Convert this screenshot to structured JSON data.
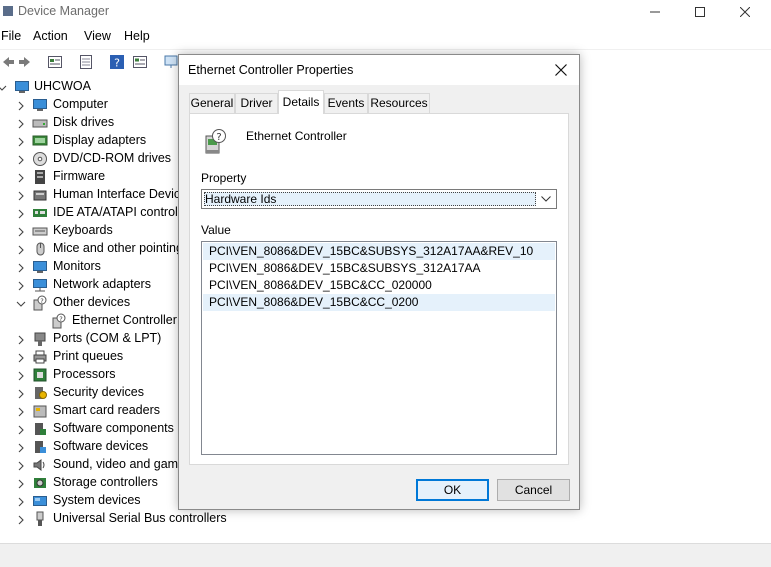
{
  "window": {
    "title": "Device Manager",
    "controls": [
      "minimize-icon",
      "maximize-icon",
      "close-icon"
    ]
  },
  "menu": {
    "items": [
      "File",
      "Action",
      "View",
      "Help"
    ]
  },
  "toolbar": {
    "icons": [
      "back-arrow-icon",
      "forward-arrow-icon",
      "properties-icon",
      "update-driver-icon",
      "help-icon",
      "action-view-icon",
      "scan-icon"
    ]
  },
  "tree": {
    "root": "UHCWOA",
    "items": [
      {
        "label": "Computer",
        "icon": "computer-icon"
      },
      {
        "label": "Disk drives",
        "icon": "disk-icon"
      },
      {
        "label": "Display adapters",
        "icon": "display-icon"
      },
      {
        "label": "DVD/CD-ROM drives",
        "icon": "dvd-icon"
      },
      {
        "label": "Firmware",
        "icon": "firmware-icon"
      },
      {
        "label": "Human Interface Device",
        "icon": "hid-icon"
      },
      {
        "label": "IDE ATA/ATAPI controlle",
        "icon": "ide-icon"
      },
      {
        "label": "Keyboards",
        "icon": "keyboard-icon"
      },
      {
        "label": "Mice and other pointing",
        "icon": "mouse-icon"
      },
      {
        "label": "Monitors",
        "icon": "monitor-icon"
      },
      {
        "label": "Network adapters",
        "icon": "network-icon"
      },
      {
        "label": "Other devices",
        "icon": "unknown-device-icon",
        "expanded": true
      },
      {
        "label": "Ethernet Controller",
        "icon": "unknown-device-icon",
        "child": true
      },
      {
        "label": "Ports (COM & LPT)",
        "icon": "port-icon"
      },
      {
        "label": "Print queues",
        "icon": "printer-icon"
      },
      {
        "label": "Processors",
        "icon": "processor-icon"
      },
      {
        "label": "Security devices",
        "icon": "security-icon"
      },
      {
        "label": "Smart card readers",
        "icon": "smartcard-icon"
      },
      {
        "label": "Software components",
        "icon": "software-component-icon"
      },
      {
        "label": "Software devices",
        "icon": "software-device-icon"
      },
      {
        "label": "Sound, video and game",
        "icon": "sound-icon"
      },
      {
        "label": "Storage controllers",
        "icon": "storage-icon"
      },
      {
        "label": "System devices",
        "icon": "system-icon"
      },
      {
        "label": "Universal Serial Bus controllers",
        "icon": "usb-icon"
      }
    ]
  },
  "dialog": {
    "title": "Ethernet Controller Properties",
    "tabs": [
      "General",
      "Driver",
      "Details",
      "Events",
      "Resources"
    ],
    "active_tab": "Details",
    "device_name": "Ethernet Controller",
    "property_label": "Property",
    "property_value": "Hardware Ids",
    "value_label": "Value",
    "values": [
      "PCI\\VEN_8086&DEV_15BC&SUBSYS_312A17AA&REV_10",
      "PCI\\VEN_8086&DEV_15BC&SUBSYS_312A17AA",
      "PCI\\VEN_8086&DEV_15BC&CC_020000",
      "PCI\\VEN_8086&DEV_15BC&CC_0200"
    ],
    "highlighted_rows": [
      0,
      3
    ],
    "ok_label": "OK",
    "cancel_label": "Cancel"
  },
  "colors": {
    "selection": "#e5f1fb",
    "accent": "#0078d7",
    "dialog_bg": "#f0f0f0"
  }
}
